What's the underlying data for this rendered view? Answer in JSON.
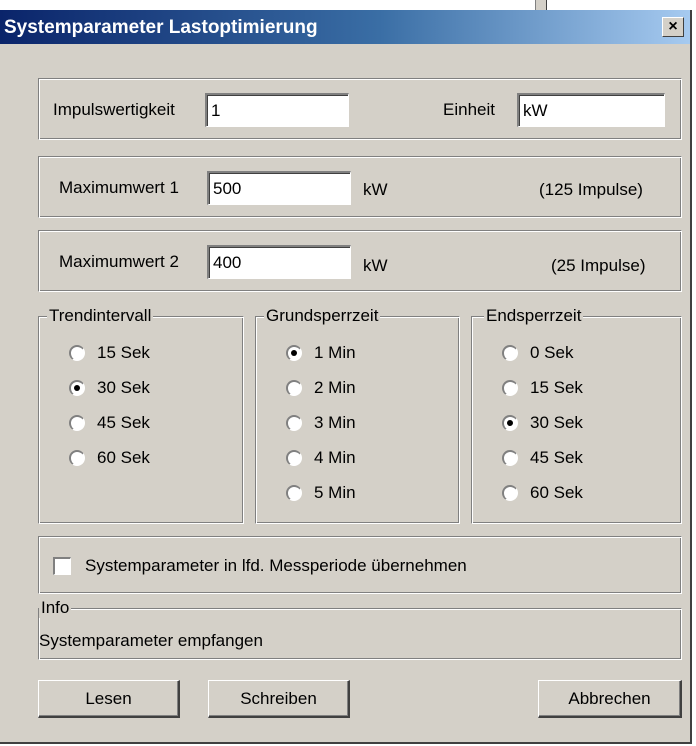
{
  "window": {
    "title": "Systemparameter Lastoptimierung",
    "close_glyph": "×"
  },
  "impuls": {
    "label": "Impulswertigkeit",
    "value": "1",
    "unit_label": "Einheit",
    "unit_value": "kW"
  },
  "max1": {
    "label": "Maximumwert 1",
    "value": "500",
    "unit": "kW",
    "impulses": "(125 Impulse)"
  },
  "max2": {
    "label": "Maximumwert 2",
    "value": "400",
    "unit": "kW",
    "impulses": "(25 Impulse)"
  },
  "trend": {
    "title": "Trendintervall",
    "options": [
      "15 Sek",
      "30 Sek",
      "45 Sek",
      "60 Sek"
    ],
    "selected": "30 Sek"
  },
  "grund": {
    "title": "Grundsperrzeit",
    "options": [
      "1 Min",
      "2 Min",
      "3 Min",
      "4 Min",
      "5 Min"
    ],
    "selected": "1 Min"
  },
  "end": {
    "title": "Endsperrzeit",
    "options": [
      "0 Sek",
      "15 Sek",
      "30 Sek",
      "45 Sek",
      "60 Sek"
    ],
    "selected": "30 Sek"
  },
  "apply_checkbox": {
    "label": "Systemparameter in lfd. Messperiode übernehmen",
    "checked": false
  },
  "info": {
    "title": "Info",
    "text": "Systemparameter empfangen"
  },
  "buttons": {
    "read": "Lesen",
    "write": "Schreiben",
    "cancel": "Abbrechen"
  }
}
